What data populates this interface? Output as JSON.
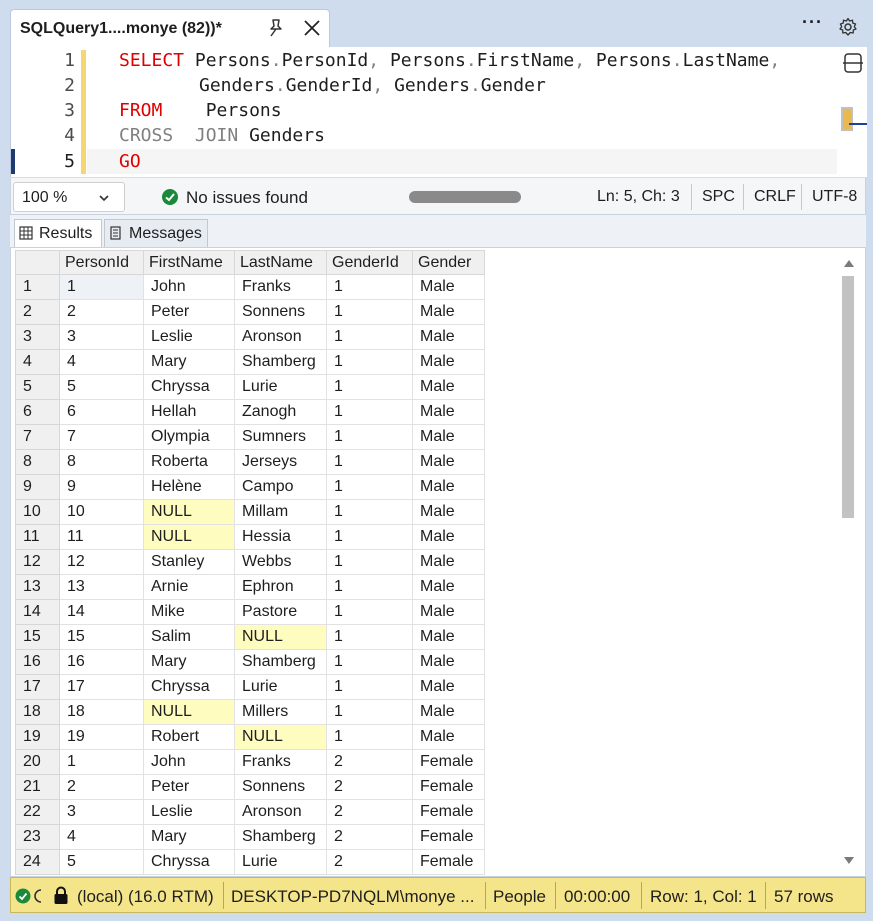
{
  "tab": {
    "title": "SQLQuery1....monye (82))*"
  },
  "editor": {
    "line_numbers": [
      "1",
      "2",
      "3",
      "4",
      "5"
    ],
    "lines": {
      "l1_kw": "SELECT",
      "l1_rest_a": "Persons",
      "l1_dot1": ".",
      "l1_rest_b": "PersonId",
      "l1_comma1": ",",
      "l1_rest_c": "Persons",
      "l1_dot2": ".",
      "l1_rest_d": "FirstName",
      "l1_comma2": ",",
      "l1_rest_e": "Persons",
      "l1_dot3": ".",
      "l1_rest_f": "LastName",
      "l1_comma3": ",",
      "l2_a": "Genders",
      "l2_dot1": ".",
      "l2_b": "GenderId",
      "l2_comma": ",",
      "l2_c": "Genders",
      "l2_dot2": ".",
      "l2_d": "Gender",
      "l3_kw": "FROM",
      "l3_rest": "Persons",
      "l4_kw": "CROSS",
      "l4_kw2": "JOIN",
      "l4_rest": "Genders",
      "l5_kw": "GO"
    }
  },
  "editor_status": {
    "zoom": "100 %",
    "issues": "No issues found",
    "position": "Ln: 5, Ch: 3",
    "whitespace": "SPC",
    "line_ending": "CRLF",
    "encoding": "UTF-8"
  },
  "results_tabs": {
    "results": "Results",
    "messages": "Messages"
  },
  "grid": {
    "columns": [
      "PersonId",
      "FirstName",
      "LastName",
      "GenderId",
      "Gender"
    ],
    "rows": [
      [
        "1",
        "1",
        "John",
        "Franks",
        "1",
        "Male"
      ],
      [
        "2",
        "2",
        "Peter",
        "Sonnens",
        "1",
        "Male"
      ],
      [
        "3",
        "3",
        "Leslie",
        "Aronson",
        "1",
        "Male"
      ],
      [
        "4",
        "4",
        "Mary",
        "Shamberg",
        "1",
        "Male"
      ],
      [
        "5",
        "5",
        "Chryssa",
        "Lurie",
        "1",
        "Male"
      ],
      [
        "6",
        "6",
        "Hellah",
        "Zanogh",
        "1",
        "Male"
      ],
      [
        "7",
        "7",
        "Olympia",
        "Sumners",
        "1",
        "Male"
      ],
      [
        "8",
        "8",
        "Roberta",
        "Jerseys",
        "1",
        "Male"
      ],
      [
        "9",
        "9",
        "Helène",
        "Campo",
        "1",
        "Male"
      ],
      [
        "10",
        "10",
        "NULL",
        "Millam",
        "1",
        "Male"
      ],
      [
        "11",
        "11",
        "NULL",
        "Hessia",
        "1",
        "Male"
      ],
      [
        "12",
        "12",
        "Stanley",
        "Webbs",
        "1",
        "Male"
      ],
      [
        "13",
        "13",
        "Arnie",
        "Ephron",
        "1",
        "Male"
      ],
      [
        "14",
        "14",
        "Mike",
        "Pastore",
        "1",
        "Male"
      ],
      [
        "15",
        "15",
        "Salim",
        "NULL",
        "1",
        "Male"
      ],
      [
        "16",
        "16",
        "Mary",
        "Shamberg",
        "1",
        "Male"
      ],
      [
        "17",
        "17",
        "Chryssa",
        "Lurie",
        "1",
        "Male"
      ],
      [
        "18",
        "18",
        "NULL",
        "Millers",
        "1",
        "Male"
      ],
      [
        "19",
        "19",
        "Robert",
        "NULL",
        "1",
        "Male"
      ],
      [
        "20",
        "1",
        "John",
        "Franks",
        "2",
        "Female"
      ],
      [
        "21",
        "2",
        "Peter",
        "Sonnens",
        "2",
        "Female"
      ],
      [
        "22",
        "3",
        "Leslie",
        "Aronson",
        "2",
        "Female"
      ],
      [
        "23",
        "4",
        "Mary",
        "Shamberg",
        "2",
        "Female"
      ],
      [
        "24",
        "5",
        "Chryssa",
        "Lurie",
        "2",
        "Female"
      ]
    ]
  },
  "status_bar": {
    "server": "(local) (16.0 RTM)",
    "user": "DESKTOP-PD7NQLM\\monye ...",
    "database": "People",
    "elapsed": "00:00:00",
    "cursor": "Row: 1, Col: 1",
    "row_count": "57 rows"
  },
  "colors": {
    "keyword": "#e00000",
    "null_cell": "#fffcc0",
    "status_bar": "#f4e58a",
    "frame": "#cfdcee"
  }
}
